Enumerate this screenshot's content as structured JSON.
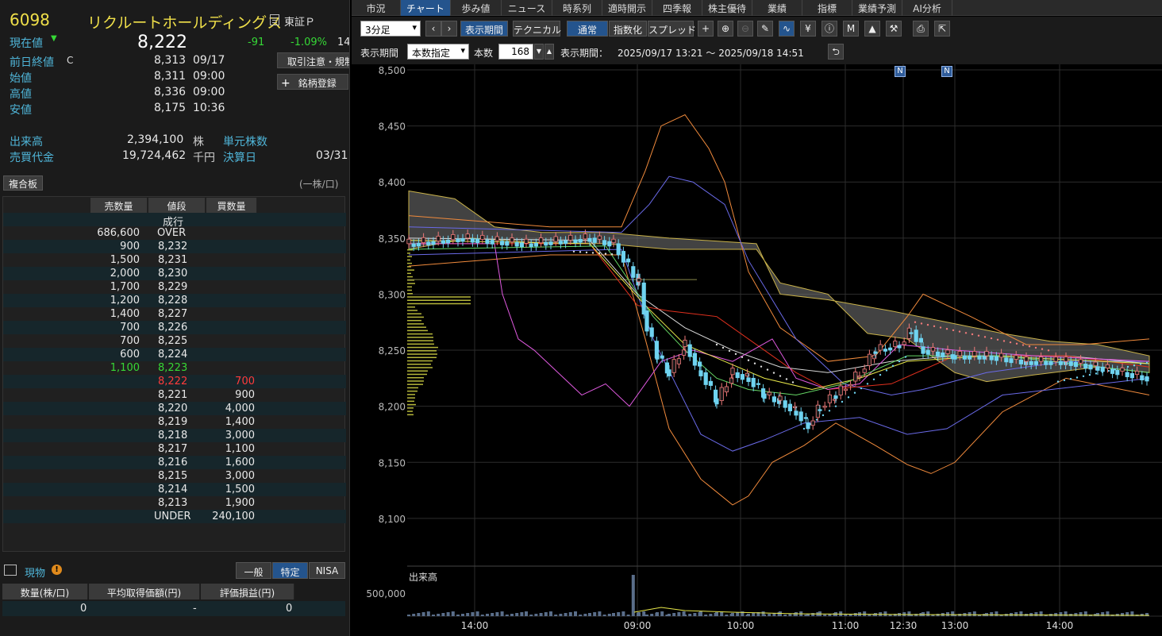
{
  "stock": {
    "code": "6098",
    "name": "リクルートホールディングス",
    "market": "東証Ｐ",
    "current_label": "現在値",
    "current_price": "8,222",
    "change": "-91",
    "change_pct": "-1.09%",
    "cut_time": "14",
    "prev_close_label": "前日終値",
    "prev_close_flag": "C",
    "prev_close": "8,313",
    "prev_close_date": "09/17",
    "open_label": "始値",
    "open": "8,311",
    "open_time": "09:00",
    "high_label": "高値",
    "high": "8,336",
    "high_time": "09:00",
    "low_label": "安値",
    "low": "8,175",
    "low_time": "10:36",
    "volume_label": "出来高",
    "volume": "2,394,100",
    "volume_unit": "株",
    "unit_shares_label": "単元株数",
    "turnover_label": "売買代金",
    "turnover": "19,724,462",
    "turnover_unit": "千円",
    "settlement_label": "決算日",
    "settlement": "03/31",
    "notice_button": "取引注意・規制",
    "register_button": "銘柄登録",
    "register_plus": "+"
  },
  "board": {
    "tab": "複合板",
    "per": "(一株/口)",
    "headers": [
      "売数量",
      "値段",
      "買数量"
    ],
    "market_order": "成行",
    "rows": [
      {
        "sell": "686,600",
        "price": "OVER",
        "buy": ""
      },
      {
        "sell": "900",
        "price": "8,232",
        "buy": ""
      },
      {
        "sell": "1,500",
        "price": "8,231",
        "buy": ""
      },
      {
        "sell": "2,000",
        "price": "8,230",
        "buy": ""
      },
      {
        "sell": "1,700",
        "price": "8,229",
        "buy": ""
      },
      {
        "sell": "1,200",
        "price": "8,228",
        "buy": ""
      },
      {
        "sell": "1,400",
        "price": "8,227",
        "buy": ""
      },
      {
        "sell": "700",
        "price": "8,226",
        "buy": ""
      },
      {
        "sell": "700",
        "price": "8,225",
        "buy": ""
      },
      {
        "sell": "600",
        "price": "8,224",
        "buy": ""
      },
      {
        "sell": "1,100",
        "price": "8,223",
        "buy": ""
      },
      {
        "sell": "",
        "price": "8,222",
        "buy": "700"
      },
      {
        "sell": "",
        "price": "8,221",
        "buy": "900"
      },
      {
        "sell": "",
        "price": "8,220",
        "buy": "4,000"
      },
      {
        "sell": "",
        "price": "8,219",
        "buy": "1,400"
      },
      {
        "sell": "",
        "price": "8,218",
        "buy": "3,000"
      },
      {
        "sell": "",
        "price": "8,217",
        "buy": "1,100"
      },
      {
        "sell": "",
        "price": "8,216",
        "buy": "1,600"
      },
      {
        "sell": "",
        "price": "8,215",
        "buy": "3,000"
      },
      {
        "sell": "",
        "price": "8,214",
        "buy": "1,500"
      },
      {
        "sell": "",
        "price": "8,213",
        "buy": "1,900"
      },
      {
        "sell": "",
        "price": "UNDER",
        "buy": "240,100"
      }
    ]
  },
  "position": {
    "title": "現物",
    "warn": "!",
    "tabs": [
      "一般",
      "特定",
      "NISA"
    ],
    "headers": [
      "数量(株/口)",
      "平均取得価額(円)",
      "評価損益(円)"
    ],
    "values": [
      "0",
      "-",
      "0"
    ]
  },
  "tabs": [
    "市況",
    "チャート",
    "歩み値",
    "ニュース",
    "時系列",
    "適時開示",
    "四季報",
    "株主優待",
    "業績",
    "指標",
    "業績予測",
    "AI分析"
  ],
  "toolbar": {
    "interval": "3分足",
    "period_btn": "表示期間",
    "technical_btn": "テクニカル",
    "normal_btn": "通常",
    "index_btn": "指数化",
    "spread_btn": "スプレッド",
    "period_label": "表示期間",
    "period_mode": "本数指定",
    "count_label": "本数",
    "count": "168",
    "range_label": "表示期間：",
    "range": "2025/09/17 13:21 ～ 2025/09/18 14:51",
    "icons": [
      "crosshair-icon",
      "zoom-in-icon",
      "zoom-out-icon",
      "pencil-icon",
      "wave-icon",
      "yen-icon",
      "info-icon",
      "my-icon",
      "area-icon",
      "wrench-icon",
      "print-icon",
      "popout-icon"
    ]
  },
  "chart_data": {
    "type": "candlestick",
    "yticks": [
      "8,500",
      "8,450",
      "8,400",
      "8,350",
      "8,300",
      "8,250",
      "8,200",
      "8,150",
      "8,100"
    ],
    "xticks": [
      "14:00",
      "09:00",
      "10:00",
      "11:00",
      "12:30",
      "13:00",
      "14:00"
    ],
    "ylim": [
      8090,
      8500
    ],
    "news_marks": [
      "N",
      "N"
    ],
    "volume_label": "出来高",
    "volume_tick": "500,000",
    "colors": {
      "up": "#6fd3f0",
      "down": "#6fd3f0",
      "grid": "#2c2c2c"
    }
  }
}
